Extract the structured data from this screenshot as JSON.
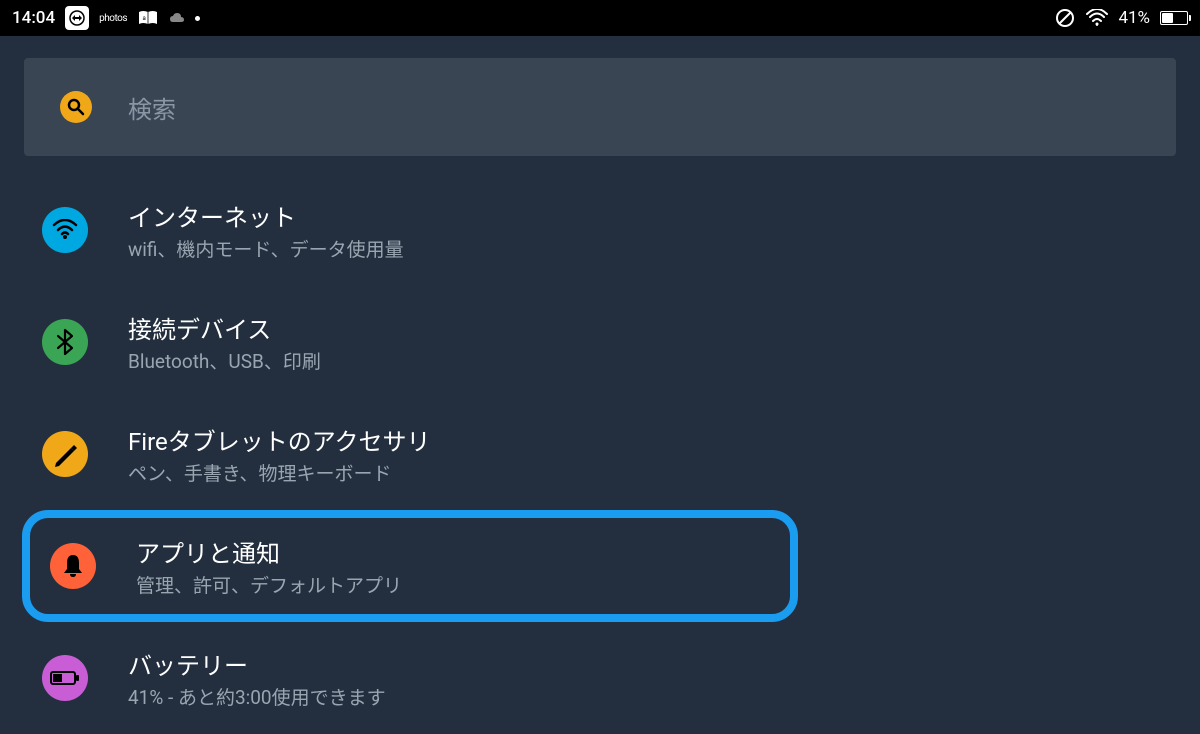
{
  "status": {
    "time": "14:04",
    "battery_pct": "41%"
  },
  "search": {
    "placeholder": "検索"
  },
  "items": [
    {
      "title": "インターネット",
      "subtitle": "wifi、機内モード、データ使用量"
    },
    {
      "title": "接続デバイス",
      "subtitle": "Bluetooth、USB、印刷"
    },
    {
      "title": "Fireタブレットのアクセサリ",
      "subtitle": "ペン、手書き、物理キーボード"
    },
    {
      "title": "アプリと通知",
      "subtitle": "管理、許可、デフォルトアプリ"
    },
    {
      "title": "バッテリー",
      "subtitle": "41% - あと約3:00使用できます"
    }
  ]
}
